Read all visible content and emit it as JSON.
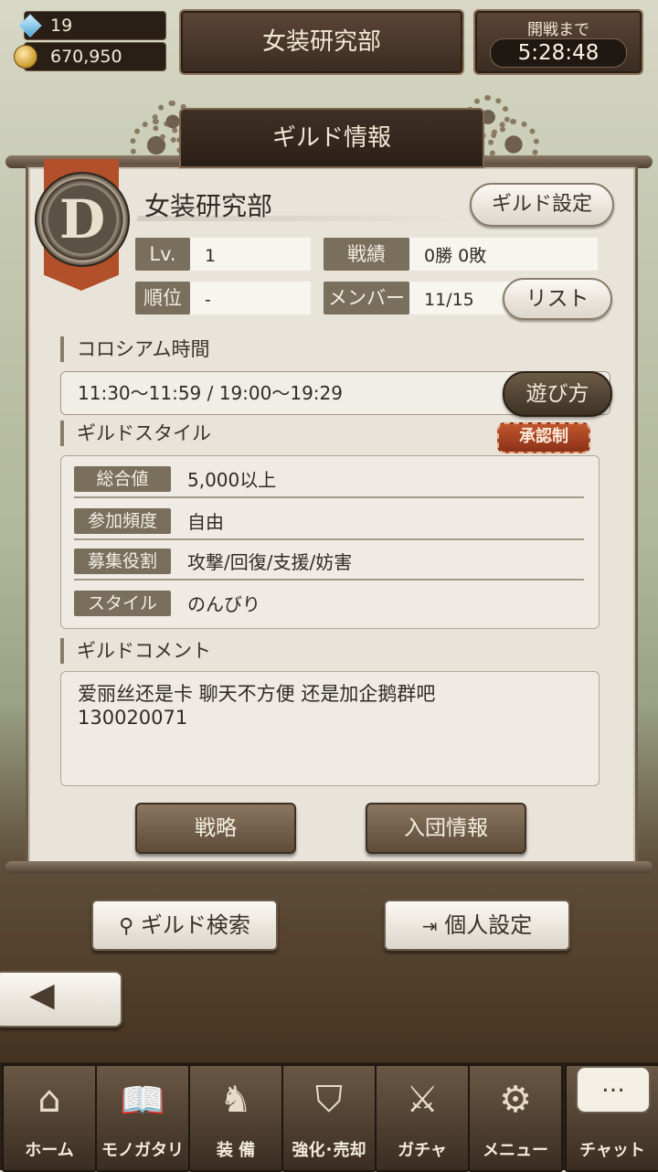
{
  "top_bar": {
    "crystals": "19",
    "coins": "670,950",
    "title": "女装研究部",
    "timer_label": "開戦まで",
    "timer_value": "5:28:48"
  },
  "panel": {
    "header": "ギルド情報",
    "emblem_letter": "D",
    "guild_name": "女装研究部",
    "settings_button": "ギルド設定",
    "stats": {
      "level_label": "Lv.",
      "level_value": "1",
      "record_label": "戦績",
      "record_value": "0勝 0敗",
      "rank_label": "順位",
      "rank_value": "-",
      "members_label": "メンバー",
      "members_value": "11/15",
      "list_button": "リスト"
    },
    "coliseum": {
      "title": "コロシアム時間",
      "times": "11:30〜11:59  /  19:00〜19:29",
      "howto_button": "遊び方"
    },
    "style": {
      "title": "ギルドスタイル",
      "approval_badge": "承認制",
      "rows": [
        {
          "label": "総合値",
          "value": "5,000以上"
        },
        {
          "label": "参加頻度",
          "value": "自由"
        },
        {
          "label": "募集役割",
          "value": "攻撃/回復/支援/妨害"
        },
        {
          "label": "スタイル",
          "value": "のんびり"
        }
      ]
    },
    "comment": {
      "title": "ギルドコメント",
      "line1": "爱丽丝还是卡 聊天不方便  还是加企鹅群吧",
      "line2": "130020071"
    },
    "strategy_button": "戦略",
    "join_info_button": "入団情報"
  },
  "actions": {
    "guild_search": "ギルド検索",
    "personal_settings": "個人設定"
  },
  "nav": [
    {
      "label": "ホーム",
      "icon": "castle-icon",
      "glyph": "⌂"
    },
    {
      "label": "モノガタリ",
      "icon": "book-icon",
      "glyph": "📖"
    },
    {
      "label": "装 備",
      "icon": "puppet-icon",
      "glyph": "♞"
    },
    {
      "label": "強化･売却",
      "icon": "shield-icon",
      "glyph": "⛉"
    },
    {
      "label": "ガチャ",
      "icon": "swords-icon",
      "glyph": "⚔"
    },
    {
      "label": "メニュー",
      "icon": "gears-icon",
      "glyph": "⚙"
    },
    {
      "label": "チャット",
      "icon": "chat-icon",
      "glyph": "…"
    }
  ]
}
